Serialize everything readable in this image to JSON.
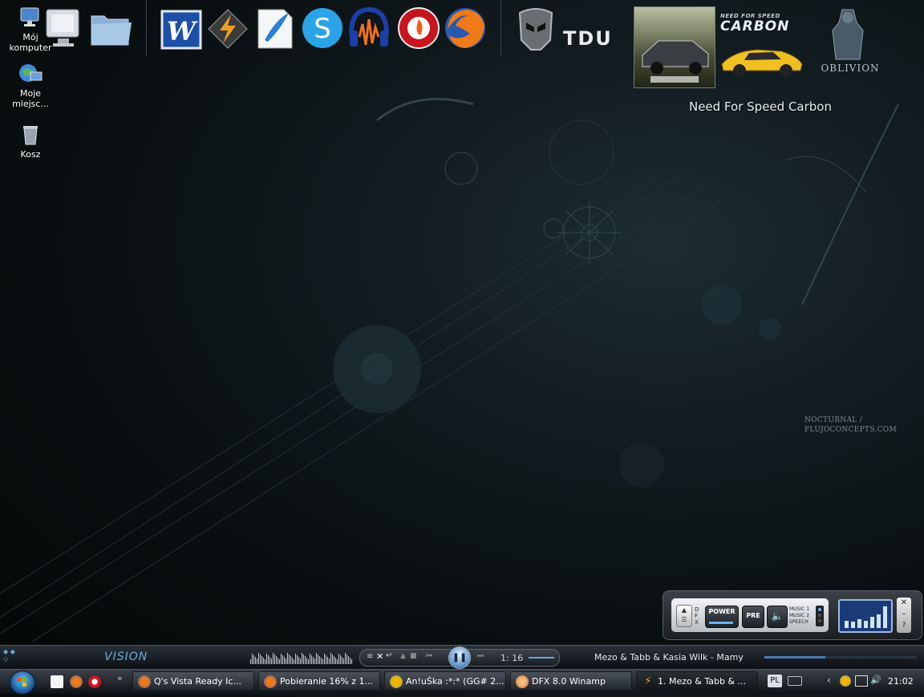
{
  "desktop": {
    "icons": [
      {
        "label": "Mój komputer",
        "icon": "my-computer-icon"
      },
      {
        "label": "Moje miejsc...",
        "icon": "network-places-icon"
      },
      {
        "label": "Kosz",
        "icon": "recycle-bin-icon"
      }
    ]
  },
  "dock": {
    "icons": [
      "monitor-icon",
      "folder-icon",
      "word-icon",
      "winamp-icon",
      "paint-icon",
      "skype-icon",
      "audacity-icon",
      "nero-icon",
      "firefox-icon",
      "helmet-icon"
    ],
    "tdu_label": "TDU",
    "nfs_logo_top": "NEED FOR SPEED",
    "nfs_logo": "CARBON",
    "oblivion_label": "OBLIVION",
    "hover_label": "Need For Speed Carbon"
  },
  "wallpaper": {
    "credit_line1": "NOCTURNAL /",
    "credit_line2": "FLUJOCONCEPTS.COM"
  },
  "dfx": {
    "power": "POWER",
    "pre": "PRE",
    "music1": "MUSIC 1",
    "music2": "MUSIC 2",
    "speech": "SPEECH",
    "side_letters": "DFX",
    "meter_levels": [
      0.3,
      0.25,
      0.35,
      0.3,
      0.45,
      0.55,
      0.9
    ]
  },
  "winamp": {
    "brand": "VISION",
    "time": "1: 16",
    "now_playing": "Mezo & Tabb & Kasia Wilk - Mamy",
    "progress": 0.4
  },
  "taskbar": {
    "tasks": [
      {
        "label": "Q's Vista Ready Ic...",
        "icon": "firefox-icon",
        "color": "#e66a1c"
      },
      {
        "label": "Pobieranie 16% z 1...",
        "icon": "firefox-icon",
        "color": "#e66a1c"
      },
      {
        "label": "An!uŚka :*:* (GG# 2...",
        "icon": "gadu-gadu-icon",
        "color": "#f4b400"
      },
      {
        "label": "DFX 8.0 Winamp",
        "icon": "dfx-icon",
        "color": "#d06a2a"
      },
      {
        "label": "1. Mezo & Tabb & ...",
        "icon": "winamp-icon",
        "color": "#f0a020"
      }
    ],
    "language": "PL",
    "clock": "21:02"
  }
}
